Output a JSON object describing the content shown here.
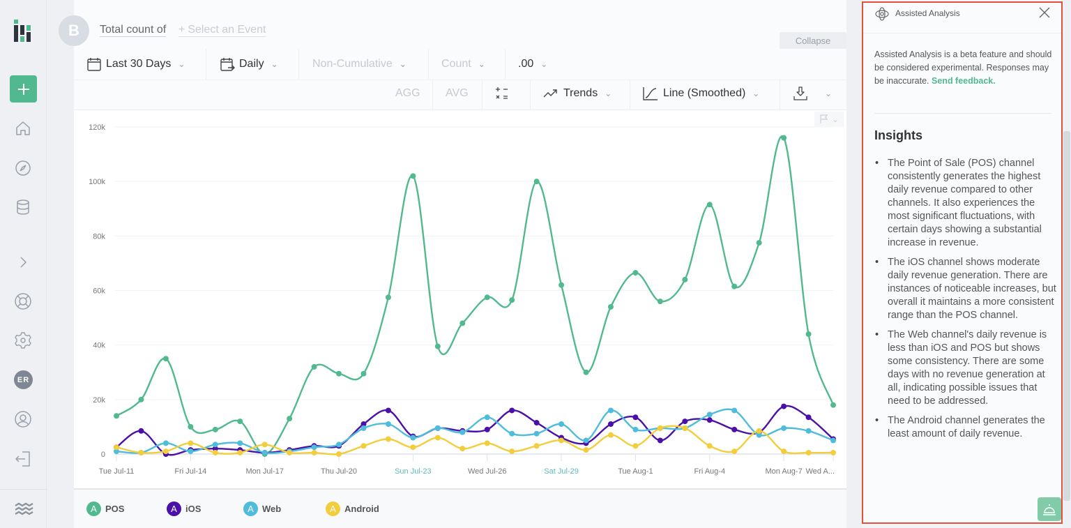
{
  "query": {
    "badge": "B",
    "total_count_label": "Total count of",
    "select_event_plus": "+",
    "select_event_label": "Select an Event",
    "collapse_label": "Collapse"
  },
  "toolbar": {
    "date_range": "Last 30 Days",
    "interval": "Daily",
    "cumulative": "Non-Cumulative",
    "measure": "Count",
    "decimals": ".00",
    "agg_label": "AGG",
    "avg_label": "AVG",
    "formula_icon": "formula-icon",
    "trends_label": "Trends",
    "chart_type": "Line (Smoothed)"
  },
  "nav": {
    "items": [
      "home",
      "explore",
      "data",
      "expand",
      "help",
      "settings",
      "account",
      "profile",
      "logout"
    ],
    "avatar_initials": "ER"
  },
  "legend": [
    {
      "letter": "A",
      "label": "POS",
      "color": "#52b98f"
    },
    {
      "letter": "A",
      "label": "iOS",
      "color": "#4a10a8"
    },
    {
      "letter": "A",
      "label": "Web",
      "color": "#4fbcdb"
    },
    {
      "letter": "A",
      "label": "Android",
      "color": "#f2cd3c"
    }
  ],
  "chart_data": {
    "type": "line",
    "smoothed": true,
    "title": "",
    "xlabel": "",
    "ylabel": "",
    "ylim": [
      0,
      120000
    ],
    "grid": true,
    "legend_position": "bottom",
    "y_ticks": [
      "0",
      "20k",
      "40k",
      "60k",
      "80k",
      "100k",
      "120k"
    ],
    "y_tick_values": [
      0,
      20000,
      40000,
      60000,
      80000,
      100000,
      120000
    ],
    "x_tick_labels": [
      {
        "index": 0,
        "label": "Tue Jul-11",
        "weekend": false
      },
      {
        "index": 3,
        "label": "Fri Jul-14",
        "weekend": false
      },
      {
        "index": 6,
        "label": "Mon Jul-17",
        "weekend": false
      },
      {
        "index": 9,
        "label": "Thu Jul-20",
        "weekend": false
      },
      {
        "index": 12,
        "label": "Sun Jul-23",
        "weekend": true
      },
      {
        "index": 15,
        "label": "Wed Jul-26",
        "weekend": false
      },
      {
        "index": 18,
        "label": "Sat Jul-29",
        "weekend": true
      },
      {
        "index": 21,
        "label": "Tue Aug-1",
        "weekend": false
      },
      {
        "index": 24,
        "label": "Fri Aug-4",
        "weekend": false
      },
      {
        "index": 27,
        "label": "Mon Aug-7",
        "weekend": false
      },
      {
        "index": 29,
        "label": "Wed A...",
        "weekend": false
      }
    ],
    "x": [
      "Jul-11",
      "Jul-12",
      "Jul-13",
      "Jul-14",
      "Jul-15",
      "Jul-16",
      "Jul-17",
      "Jul-18",
      "Jul-19",
      "Jul-20",
      "Jul-21",
      "Jul-22",
      "Jul-23",
      "Jul-24",
      "Jul-25",
      "Jul-26",
      "Jul-27",
      "Jul-28",
      "Jul-29",
      "Jul-30",
      "Jul-31",
      "Aug-1",
      "Aug-2",
      "Aug-3",
      "Aug-4",
      "Aug-5",
      "Aug-6",
      "Aug-7",
      "Aug-8",
      "Aug-9"
    ],
    "series": [
      {
        "name": "POS",
        "color": "#52b98f",
        "values": [
          14000,
          20000,
          35000,
          10000,
          9000,
          12000,
          0,
          13000,
          32000,
          29500,
          29500,
          57500,
          102000,
          39500,
          48000,
          57500,
          56500,
          100000,
          62000,
          30000,
          54000,
          66500,
          56000,
          64000,
          91500,
          61500,
          77500,
          116000,
          44000,
          18000
        ]
      },
      {
        "name": "iOS",
        "color": "#4a10a8",
        "values": [
          2500,
          8500,
          0,
          1500,
          2000,
          1500,
          500,
          1500,
          3000,
          3000,
          11000,
          16000,
          6500,
          9500,
          8500,
          9000,
          16000,
          11500,
          6000,
          4000,
          11000,
          13500,
          5000,
          12000,
          12500,
          9000,
          8000,
          17500,
          13500,
          5500
        ]
      },
      {
        "name": "Web",
        "color": "#4fbcdb",
        "values": [
          1000,
          500,
          4000,
          1000,
          3500,
          4000,
          500,
          1000,
          2500,
          3500,
          9500,
          11000,
          6000,
          9500,
          8000,
          13500,
          7500,
          7500,
          11000,
          5000,
          16000,
          9000,
          9500,
          9500,
          14500,
          16000,
          7000,
          9500,
          8500,
          5000
        ]
      },
      {
        "name": "Android",
        "color": "#f2cd3c",
        "values": [
          2500,
          500,
          1000,
          4000,
          500,
          500,
          3500,
          500,
          500,
          0,
          3000,
          5500,
          2500,
          6000,
          2000,
          4000,
          1000,
          3000,
          5000,
          1500,
          7000,
          3000,
          9500,
          9500,
          3000,
          1000,
          8500,
          1000,
          500,
          500
        ]
      }
    ]
  },
  "panel": {
    "title": "Assisted Analysis",
    "disclaimer": "Assisted Analysis is a beta feature and should be considered experimental. Responses may be inaccurate.",
    "feedback_link": "Send feedback.",
    "insights_title": "Insights",
    "insights": [
      "The Point of Sale (POS) channel consistently generates the highest daily revenue compared to other channels. It also experiences the most significant fluctuations, with certain days showing a substantial increase in revenue.",
      "The iOS channel shows moderate daily revenue generation. There are instances of noticeable increases, but overall it maintains a more consistent range than the POS channel.",
      "The Web channel's daily revenue is less than iOS and POS but shows some consistency. There are some days with no revenue generation at all, indicating possible issues that need to be addressed.",
      "The Android channel generates the least amount of daily revenue."
    ]
  }
}
